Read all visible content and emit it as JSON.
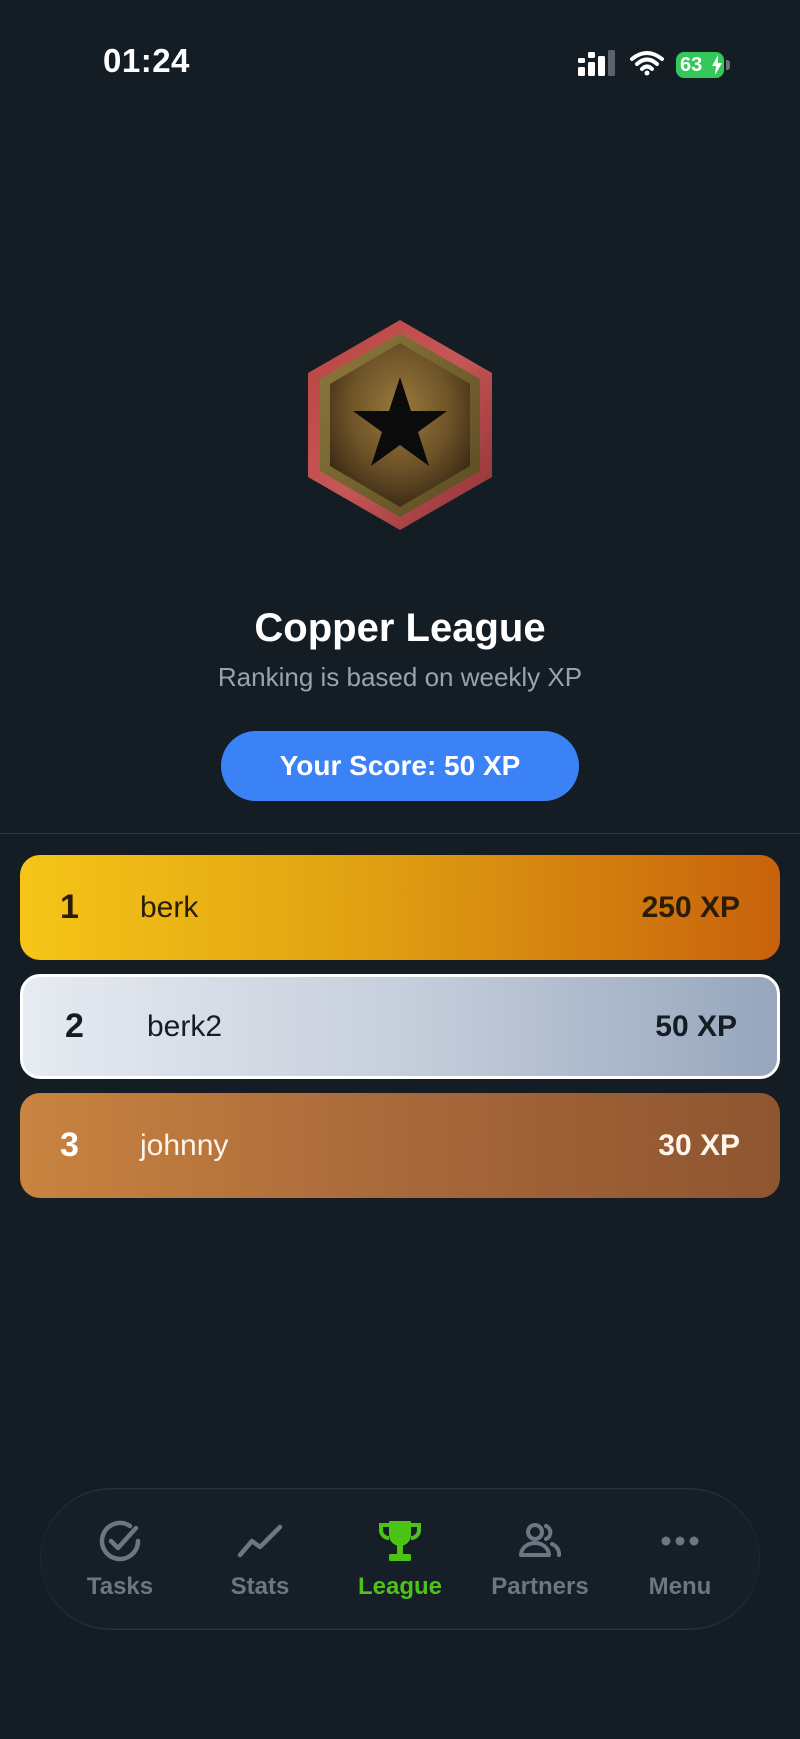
{
  "status_bar": {
    "time": "01:24",
    "battery": "63",
    "icons": [
      "cellular-signal-icon",
      "wifi-icon",
      "battery-icon"
    ]
  },
  "league": {
    "badge_icon": "copper-star-badge-icon",
    "title": "Copper League",
    "subtitle": "Ranking is based on weekly XP",
    "score_label": "Your Score: 50 XP"
  },
  "leaderboard": [
    {
      "rank": "1",
      "name": "berk",
      "xp": "250 XP"
    },
    {
      "rank": "2",
      "name": "berk2",
      "xp": "50 XP"
    },
    {
      "rank": "3",
      "name": "johnny",
      "xp": "30 XP"
    }
  ],
  "tabs": [
    {
      "label": "Tasks",
      "icon": "check-circle-icon",
      "active": false
    },
    {
      "label": "Stats",
      "icon": "trend-line-icon",
      "active": false
    },
    {
      "label": "League",
      "icon": "trophy-icon",
      "active": true
    },
    {
      "label": "Partners",
      "icon": "users-icon",
      "active": false
    },
    {
      "label": "Menu",
      "icon": "more-dots-icon",
      "active": false
    }
  ],
  "colors": {
    "background": "#141c24",
    "accent_blue": "#3b82f6",
    "active_tab": "#4cc417",
    "inactive_tab": "#6c7784",
    "battery_green": "#34c759"
  }
}
